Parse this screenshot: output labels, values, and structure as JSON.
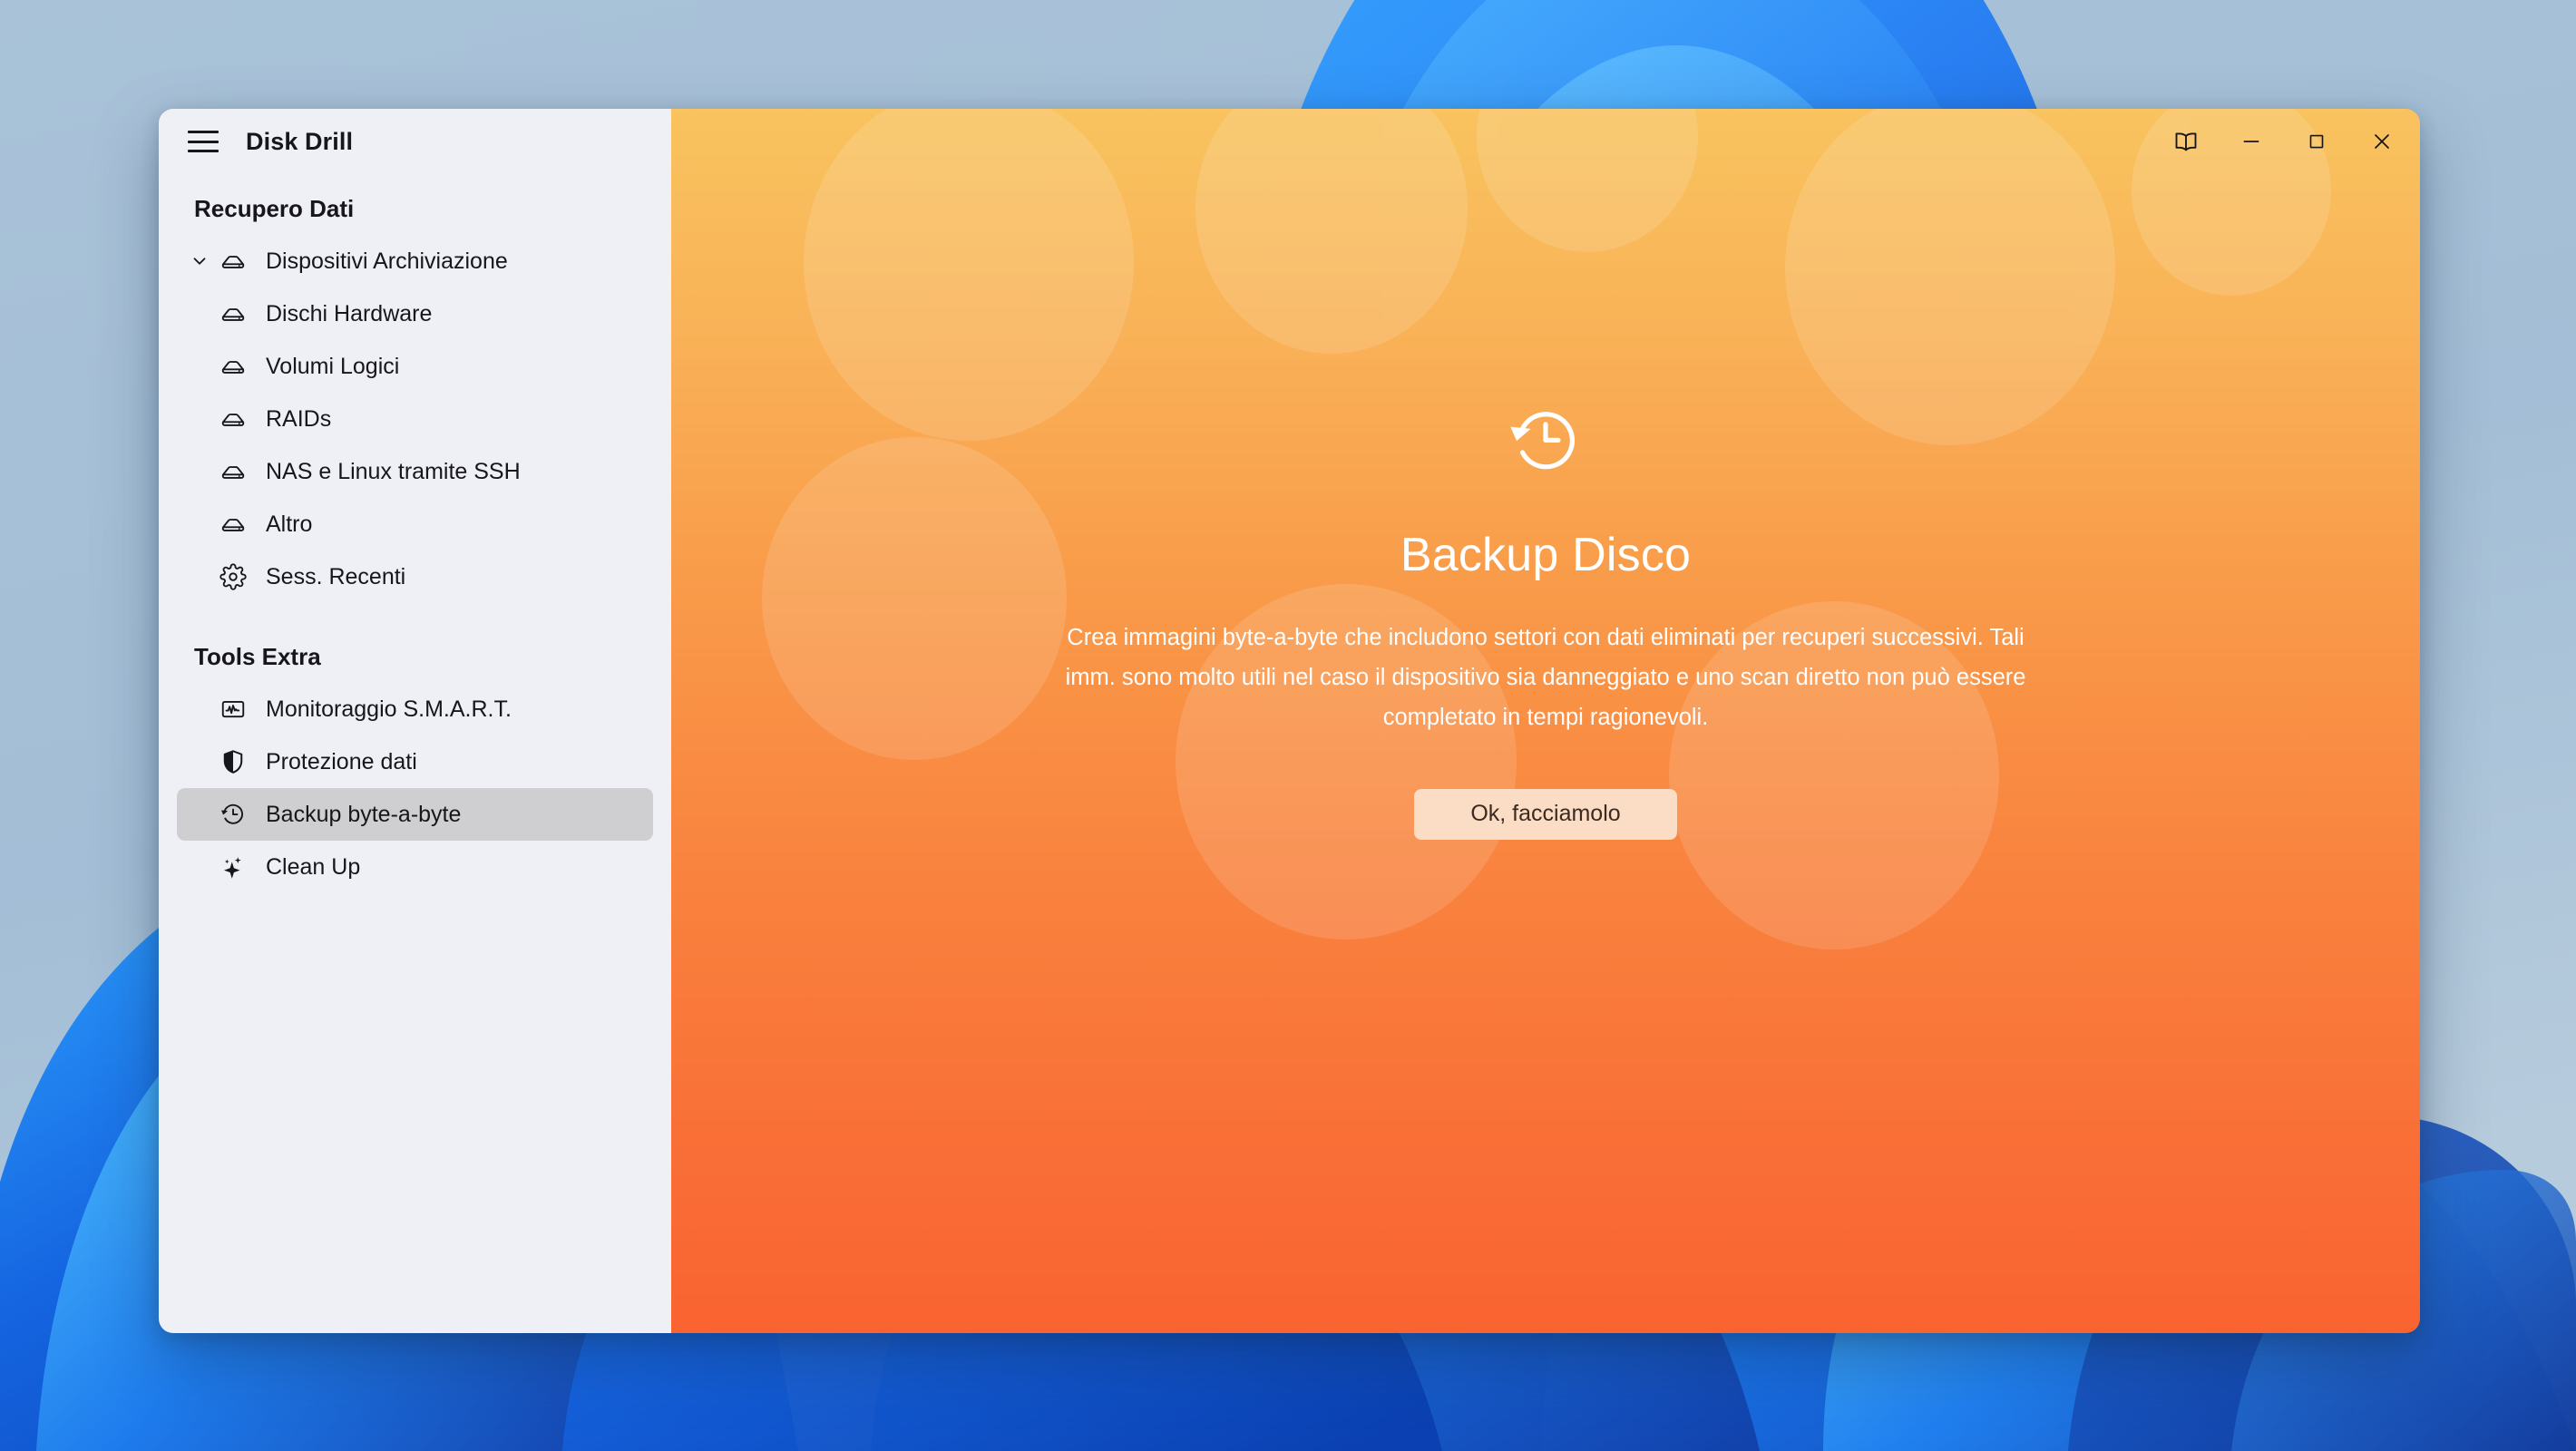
{
  "window": {
    "app_title": "Disk Drill",
    "menu_icon": "hamburger-icon",
    "controls": [
      {
        "name": "docs-book-icon",
        "label": ""
      },
      {
        "name": "minimize-icon",
        "label": ""
      },
      {
        "name": "maximize-icon",
        "label": ""
      },
      {
        "name": "close-icon",
        "label": ""
      }
    ]
  },
  "sidebar": {
    "sections": [
      {
        "title": "Recupero Dati",
        "items": [
          {
            "label": "Dispositivi Archiviazione",
            "icon": "drive-icon",
            "level": 0,
            "expanded": true,
            "selected": false
          },
          {
            "label": "Dischi Hardware",
            "icon": "drive-icon",
            "level": 1,
            "selected": false
          },
          {
            "label": "Volumi Logici",
            "icon": "drive-icon",
            "level": 1,
            "selected": false
          },
          {
            "label": "RAIDs",
            "icon": "drive-icon",
            "level": 1,
            "selected": false
          },
          {
            "label": "NAS e Linux tramite SSH",
            "icon": "drive-icon",
            "level": 1,
            "selected": false
          },
          {
            "label": "Altro",
            "icon": "drive-icon",
            "level": 1,
            "selected": false
          },
          {
            "label": "Sess. Recenti",
            "icon": "gear-icon",
            "level": 0,
            "selected": false
          }
        ]
      },
      {
        "title": "Tools Extra",
        "items": [
          {
            "label": "Monitoraggio S.M.A.R.T.",
            "icon": "pulse-monitor-icon",
            "level": 0,
            "selected": false
          },
          {
            "label": "Protezione dati",
            "icon": "shield-icon",
            "level": 0,
            "selected": false
          },
          {
            "label": "Backup byte-a-byte",
            "icon": "history-clock-icon",
            "level": 0,
            "selected": true
          },
          {
            "label": "Clean Up",
            "icon": "sparkle-icon",
            "level": 0,
            "selected": false
          }
        ]
      }
    ]
  },
  "main": {
    "hero_icon": "history-clock-icon",
    "title": "Backup Disco",
    "description": "Crea immagini byte-a-byte che includono settori con dati eliminati per recuperi successivi. Tali imm. sono molto utili nel caso il dispositivo sia danneggiato e uno scan diretto non può essere completato in tempi ragionevoli.",
    "cta_label": "Ok, facciamolo"
  },
  "colors": {
    "sidebar_bg": "#EFEFF6",
    "sidebar_selected": "#CFCFD2",
    "gradient_top": "#F9C35F",
    "gradient_bottom": "#F96330",
    "cta_bg": "#FBDCC4",
    "text_dark": "#16161B",
    "text_on_orange": "#FFFFFF",
    "desktop_bg": "#A6C0D6"
  }
}
